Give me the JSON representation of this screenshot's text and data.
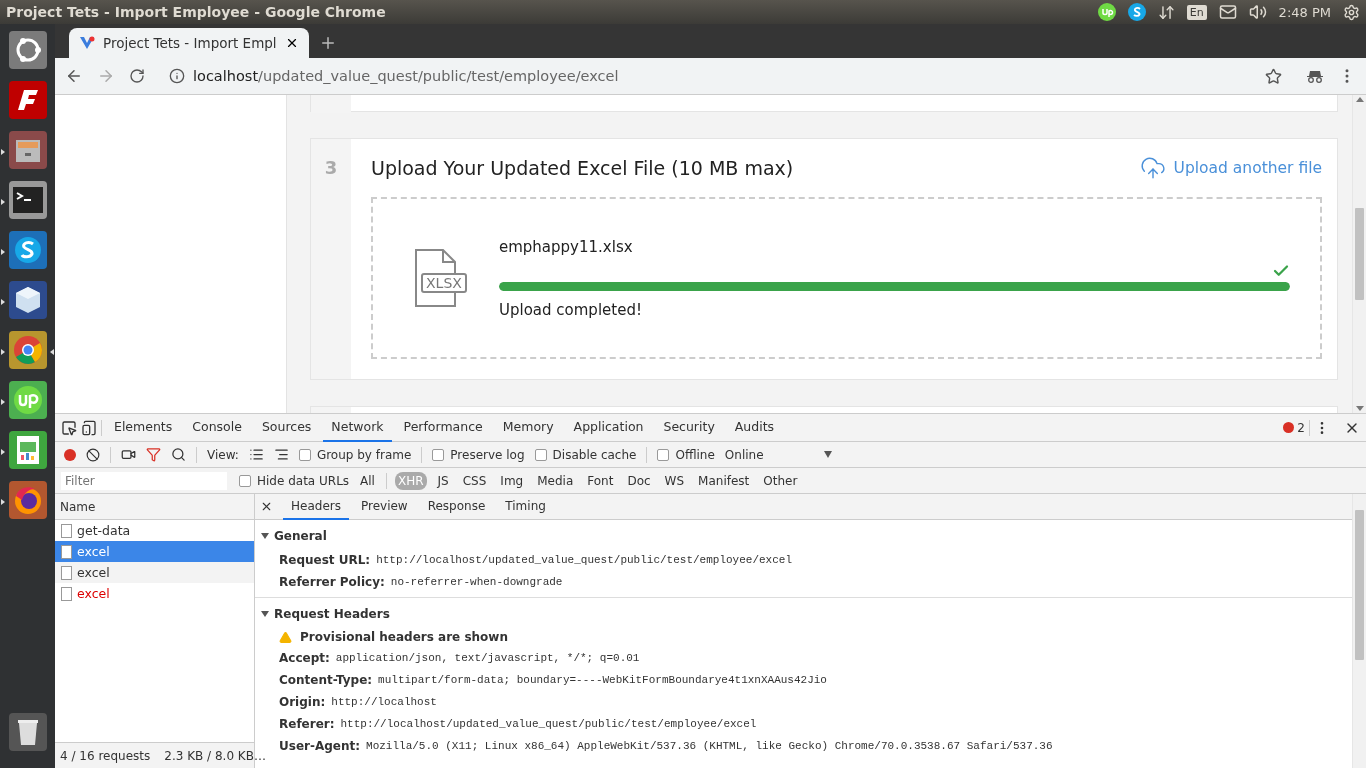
{
  "top_bar": {
    "title": "Project Tets - Import Employee - Google Chrome",
    "keyboard_layout": "En",
    "time": "2:48 PM"
  },
  "launcher": [
    {
      "kind": "dash",
      "running": false,
      "active": false
    },
    {
      "kind": "ftp",
      "running": false,
      "active": false
    },
    {
      "kind": "files",
      "running": true,
      "active": false
    },
    {
      "kind": "terminal",
      "running": true,
      "active": false
    },
    {
      "kind": "chat",
      "running": true,
      "active": false
    },
    {
      "kind": "cube",
      "running": true,
      "active": false
    },
    {
      "kind": "browser",
      "running": true,
      "active": true
    },
    {
      "kind": "freelance",
      "running": true,
      "active": false
    },
    {
      "kind": "spreadsheet",
      "running": true,
      "active": false
    },
    {
      "kind": "firefox",
      "running": true,
      "active": false
    },
    {
      "kind": "trash",
      "running": false,
      "active": false
    }
  ],
  "browser": {
    "tab_title": "Project Tets - Import Empl",
    "address_host": "localhost",
    "address_path": "/updated_value_quest/public/test/employee/excel"
  },
  "page": {
    "step": {
      "number": "3",
      "title": "Upload Your Updated Excel File (10 MB max)",
      "action": "Upload another file",
      "file": {
        "type_label": "XLSX",
        "name": "emphappy11.xlsx",
        "level": 1,
        "done": true,
        "status": "Upload completed!"
      }
    }
  },
  "devtools": {
    "tabs": [
      {
        "label": "Elements",
        "selected": false
      },
      {
        "label": "Console",
        "selected": false
      },
      {
        "label": "Sources",
        "selected": false
      },
      {
        "label": "Network",
        "selected": true
      },
      {
        "label": "Performance",
        "selected": false
      },
      {
        "label": "Memory",
        "selected": false
      },
      {
        "label": "Application",
        "selected": false
      },
      {
        "label": "Security",
        "selected": false
      },
      {
        "label": "Audits",
        "selected": false
      }
    ],
    "error_count": "2",
    "recording": true,
    "view_label": "View:",
    "options": [
      {
        "label": "Group by frame",
        "checked": false
      },
      {
        "label": "Preserve log",
        "checked": false
      },
      {
        "label": "Disable cache",
        "checked": false
      },
      {
        "label": "Offline",
        "checked": false
      }
    ],
    "throttling": "Online",
    "filter": {
      "placeholder": "Filter",
      "hide_data_urls": {
        "label": "Hide data URLs",
        "checked": false
      }
    },
    "types": [
      {
        "label": "All",
        "selected": false
      },
      {
        "label": "XHR",
        "selected": true
      },
      {
        "label": "JS",
        "selected": false
      },
      {
        "label": "CSS",
        "selected": false
      },
      {
        "label": "Img",
        "selected": false
      },
      {
        "label": "Media",
        "selected": false
      },
      {
        "label": "Font",
        "selected": false
      },
      {
        "label": "Doc",
        "selected": false
      },
      {
        "label": "WS",
        "selected": false
      },
      {
        "label": "Manifest",
        "selected": false
      },
      {
        "label": "Other",
        "selected": false
      }
    ],
    "requests": {
      "column": "Name",
      "rows": [
        {
          "name": "get-data",
          "selected": false,
          "hovered": false,
          "failed": false
        },
        {
          "name": "excel",
          "selected": true,
          "hovered": false,
          "failed": false
        },
        {
          "name": "excel",
          "selected": false,
          "hovered": true,
          "failed": false
        },
        {
          "name": "excel",
          "selected": false,
          "hovered": false,
          "failed": true
        }
      ],
      "count": "4 / 16 requests",
      "size": "2.3 KB / 8.0 KB…"
    },
    "detail_tabs": [
      {
        "label": "Headers",
        "selected": true
      },
      {
        "label": "Preview",
        "selected": false
      },
      {
        "label": "Response",
        "selected": false
      },
      {
        "label": "Timing",
        "selected": false
      }
    ],
    "sections": [
      {
        "title": "General",
        "expanded": true,
        "headers": [
          {
            "name": "Request URL:",
            "value": "http://localhost/updated_value_quest/public/test/employee/excel"
          },
          {
            "name": "Referrer Policy:",
            "value": "no-referrer-when-downgrade"
          }
        ]
      },
      {
        "title": "Request Headers",
        "expanded": true,
        "warning": "Provisional headers are shown",
        "headers": [
          {
            "name": "Accept:",
            "value": "application/json, text/javascript, */*; q=0.01"
          },
          {
            "name": "Content-Type:",
            "value": "multipart/form-data; boundary=----WebKitFormBoundarye4t1xnXAAus42Jio"
          },
          {
            "name": "Origin:",
            "value": "http://localhost"
          },
          {
            "name": "Referer:",
            "value": "http://localhost/updated_value_quest/public/test/employee/excel"
          },
          {
            "name": "User-Agent:",
            "value": "Mozilla/5.0 (X11; Linux x86_64) AppleWebKit/537.36 (KHTML, like Gecko) Chrome/70.0.3538.67 Safari/537.36"
          }
        ]
      }
    ]
  }
}
